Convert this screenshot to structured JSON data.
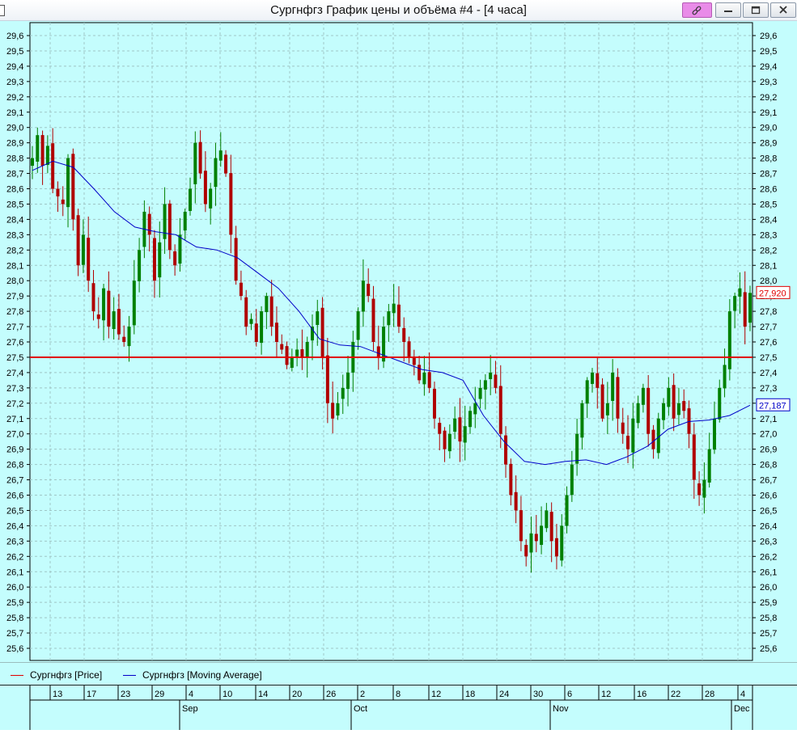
{
  "window": {
    "title": "Сургнфгз График цены и объёма #4 - [4 часа]",
    "buttons": [
      "link-icon",
      "minimize-icon",
      "maximize-icon",
      "close-icon"
    ]
  },
  "colors": {
    "background": "#c4fdfd",
    "grid": "#9fc6c6",
    "price_line": "#e00000",
    "moving_average": "#0000c8",
    "bull_candle": "#008000",
    "bear_candle": "#b00000"
  },
  "legend": {
    "price_label": "Сургнфгз [Price]",
    "ma_label": "Сургнфгз [Moving Average]"
  },
  "markers": {
    "last_price": "27,920",
    "ma_value": "27,187"
  },
  "time_axis": {
    "days": [
      "13",
      "17",
      "23",
      "29",
      "4",
      "10",
      "14",
      "20",
      "26",
      "2",
      "8",
      "12",
      "18",
      "24",
      "30",
      "6",
      "12",
      "16",
      "22",
      "28",
      "4"
    ],
    "months": [
      "Sep",
      "Oct",
      "Nov",
      "Dec"
    ]
  },
  "chart_data": {
    "type": "candlestick",
    "y_ticks": [
      "25,6",
      "25,7",
      "25,8",
      "25,9",
      "26,0",
      "26,1",
      "26,2",
      "26,3",
      "26,4",
      "26,5",
      "26,6",
      "26,7",
      "26,8",
      "26,9",
      "27,0",
      "27,1",
      "27,2",
      "27,3",
      "27,4",
      "27,5",
      "27,6",
      "27,7",
      "27,8",
      "27,9",
      "28,0",
      "28,1",
      "28,2",
      "28,3",
      "28,4",
      "28,5",
      "28,6",
      "28,7",
      "28,8",
      "28,9",
      "29,0",
      "29,1",
      "29,2",
      "29,3",
      "29,4",
      "29,5",
      "29,6"
    ],
    "ylim": [
      25.5,
      29.65
    ],
    "grid": true,
    "horizontal_level": 27.5,
    "last_price": 27.92,
    "last_ma": 27.187,
    "series": [
      {
        "name": "Сургнфгз [Price]",
        "kind": "ohlc",
        "close_path": [
          28.8,
          28.95,
          28.75,
          28.88,
          28.6,
          28.55,
          28.5,
          28.8,
          28.4,
          28.1,
          28.3,
          28.0,
          27.8,
          27.75,
          27.95,
          27.7,
          27.8,
          27.65,
          27.6,
          27.7,
          28.0,
          28.2,
          28.45,
          28.3,
          28.0,
          28.25,
          28.5,
          28.2,
          28.1,
          28.3,
          28.45,
          28.6,
          28.9,
          28.7,
          28.5,
          28.6,
          28.8,
          28.85,
          28.7,
          28.3,
          28.0,
          27.9,
          27.7,
          27.75,
          27.6,
          27.8,
          27.9,
          27.7,
          27.6,
          27.55,
          27.45,
          27.5,
          27.55,
          27.5,
          27.6,
          27.7,
          27.8,
          27.5,
          27.2,
          27.1,
          27.2,
          27.3,
          27.4,
          27.6,
          27.8,
          28.0,
          27.9,
          27.6,
          27.5,
          27.7,
          27.8,
          27.85,
          27.7,
          27.6,
          27.5,
          27.45,
          27.35,
          27.4,
          27.3,
          27.1,
          27.0,
          26.9,
          27.0,
          27.1,
          26.95,
          27.05,
          27.15,
          27.2,
          27.3,
          27.35,
          27.4,
          27.3,
          27.0,
          26.8,
          26.6,
          26.5,
          26.3,
          26.2,
          26.35,
          26.3,
          26.4,
          26.5,
          26.3,
          26.2,
          26.4,
          26.6,
          26.8,
          27.0,
          27.2,
          27.35,
          27.4,
          27.3,
          27.1,
          27.2,
          27.4,
          27.1,
          27.0,
          26.9,
          27.1,
          27.2,
          27.3,
          27.0,
          26.9,
          27.1,
          27.2,
          27.3,
          27.1,
          27.2,
          27.15,
          27.0,
          26.7,
          26.6,
          26.7,
          26.9,
          27.1,
          27.3,
          27.45,
          27.8,
          27.9,
          27.95,
          27.7,
          27.92
        ]
      },
      {
        "name": "Сургнфгз [Moving Average]",
        "kind": "line",
        "points": [
          [
            0,
            28.72
          ],
          [
            4,
            28.78
          ],
          [
            8,
            28.74
          ],
          [
            12,
            28.6
          ],
          [
            16,
            28.45
          ],
          [
            20,
            28.35
          ],
          [
            24,
            28.32
          ],
          [
            28,
            28.3
          ],
          [
            32,
            28.22
          ],
          [
            36,
            28.2
          ],
          [
            40,
            28.15
          ],
          [
            44,
            28.05
          ],
          [
            48,
            27.95
          ],
          [
            52,
            27.8
          ],
          [
            56,
            27.62
          ],
          [
            60,
            27.58
          ],
          [
            64,
            27.57
          ],
          [
            68,
            27.52
          ],
          [
            72,
            27.47
          ],
          [
            76,
            27.42
          ],
          [
            80,
            27.4
          ],
          [
            84,
            27.35
          ],
          [
            88,
            27.12
          ],
          [
            92,
            26.95
          ],
          [
            96,
            26.82
          ],
          [
            100,
            26.8
          ],
          [
            104,
            26.82
          ],
          [
            108,
            26.83
          ],
          [
            112,
            26.8
          ],
          [
            116,
            26.85
          ],
          [
            120,
            26.92
          ],
          [
            124,
            27.03
          ],
          [
            128,
            27.08
          ],
          [
            132,
            27.09
          ],
          [
            136,
            27.12
          ],
          [
            140,
            27.187
          ]
        ]
      }
    ]
  }
}
